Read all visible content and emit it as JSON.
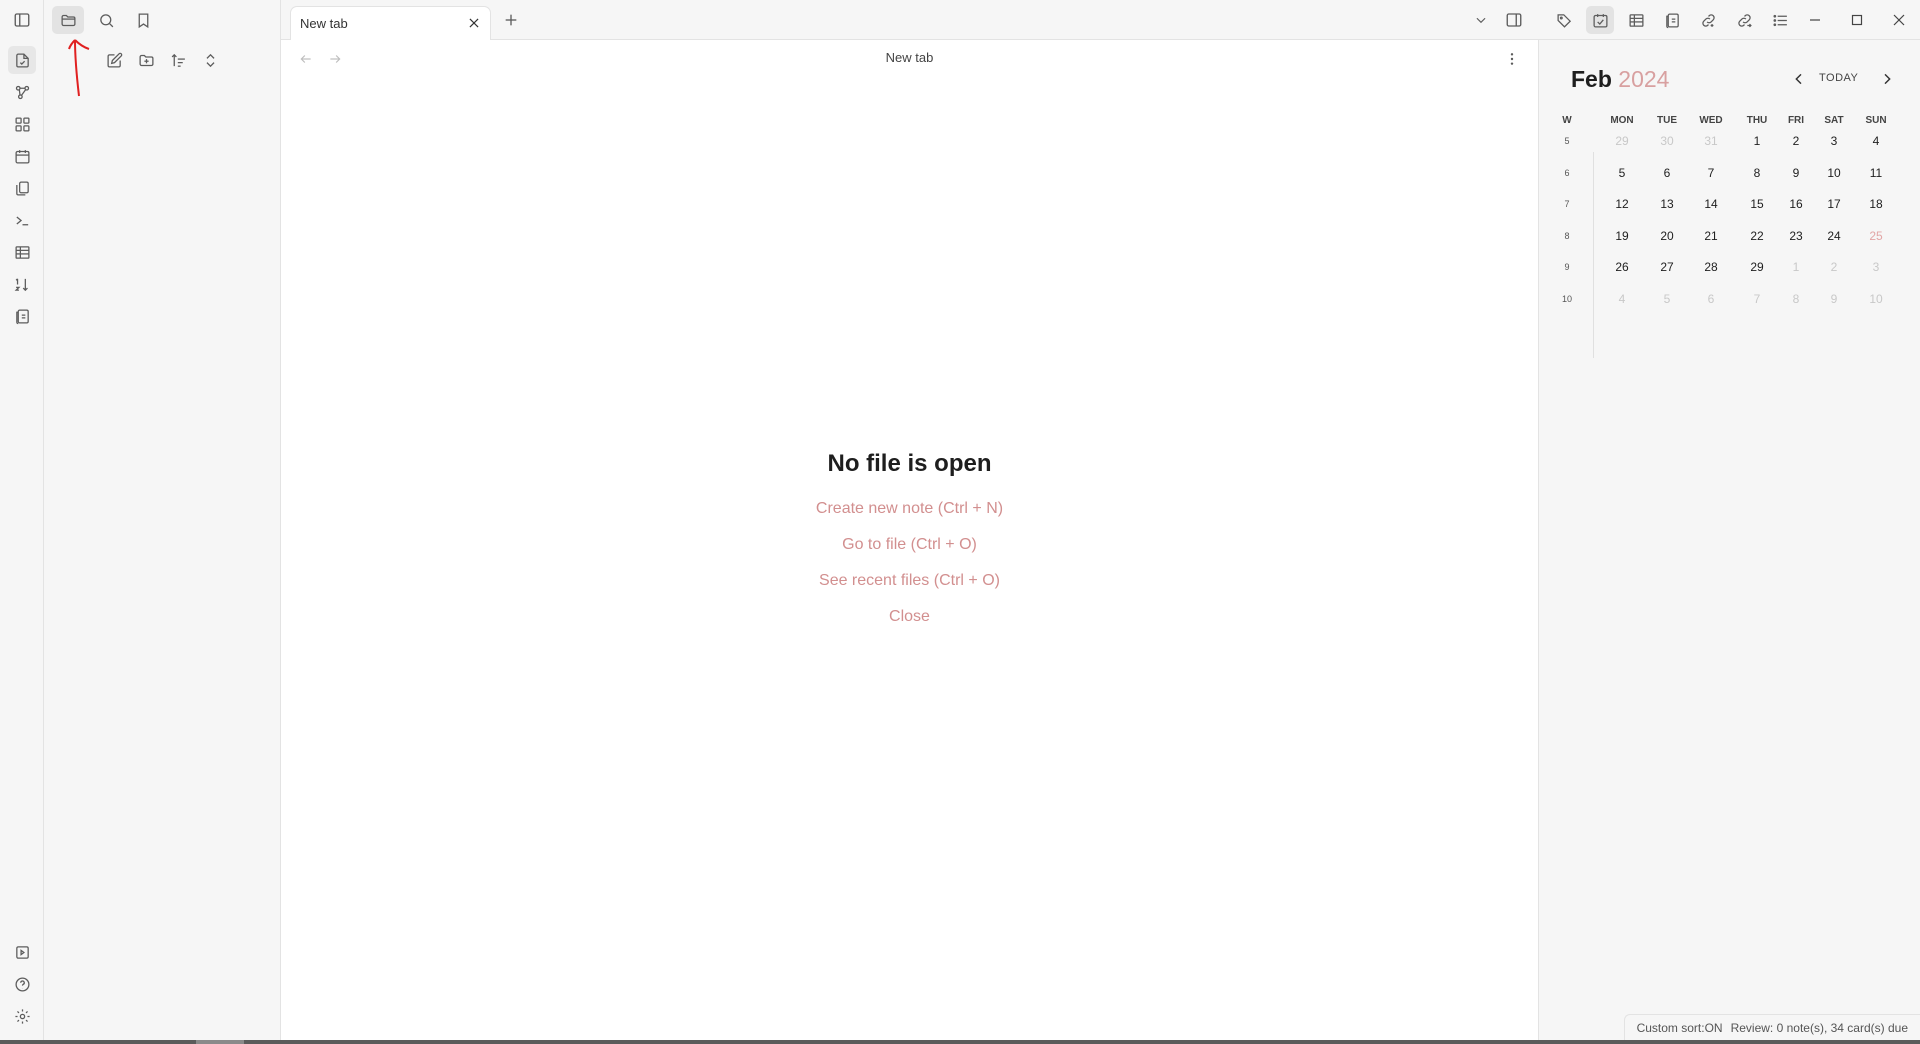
{
  "tabs": [
    {
      "title": "New tab",
      "active": true
    }
  ],
  "view": {
    "title": "New tab"
  },
  "empty_state": {
    "title": "No file is open",
    "actions": [
      "Create new note (Ctrl + N)",
      "Go to file (Ctrl + O)",
      "See recent files (Ctrl + O)",
      "Close"
    ]
  },
  "calendar": {
    "month": "Feb",
    "year": "2024",
    "today_label": "TODAY",
    "week_header": "W",
    "weekdays": [
      "MON",
      "TUE",
      "WED",
      "THU",
      "FRI",
      "SAT",
      "SUN"
    ],
    "weeks": [
      {
        "week": "5",
        "days": [
          {
            "d": "29",
            "adj": true
          },
          {
            "d": "30",
            "adj": true
          },
          {
            "d": "31",
            "adj": true
          },
          {
            "d": "1"
          },
          {
            "d": "2"
          },
          {
            "d": "3"
          },
          {
            "d": "4"
          }
        ]
      },
      {
        "week": "6",
        "days": [
          {
            "d": "5"
          },
          {
            "d": "6"
          },
          {
            "d": "7"
          },
          {
            "d": "8"
          },
          {
            "d": "9"
          },
          {
            "d": "10"
          },
          {
            "d": "11"
          }
        ]
      },
      {
        "week": "7",
        "days": [
          {
            "d": "12"
          },
          {
            "d": "13"
          },
          {
            "d": "14"
          },
          {
            "d": "15"
          },
          {
            "d": "16"
          },
          {
            "d": "17"
          },
          {
            "d": "18"
          }
        ]
      },
      {
        "week": "8",
        "days": [
          {
            "d": "19"
          },
          {
            "d": "20"
          },
          {
            "d": "21"
          },
          {
            "d": "22"
          },
          {
            "d": "23"
          },
          {
            "d": "24"
          },
          {
            "d": "25",
            "hl": true
          }
        ]
      },
      {
        "week": "9",
        "days": [
          {
            "d": "26"
          },
          {
            "d": "27"
          },
          {
            "d": "28"
          },
          {
            "d": "29"
          },
          {
            "d": "1",
            "adj": true
          },
          {
            "d": "2",
            "adj": true
          },
          {
            "d": "3",
            "adj": true
          }
        ]
      },
      {
        "week": "10",
        "days": [
          {
            "d": "4",
            "adj": true
          },
          {
            "d": "5",
            "adj": true
          },
          {
            "d": "6",
            "adj": true
          },
          {
            "d": "7",
            "adj": true
          },
          {
            "d": "8",
            "adj": true
          },
          {
            "d": "9",
            "adj": true
          },
          {
            "d": "10",
            "adj": true
          }
        ]
      }
    ]
  },
  "status_bar": {
    "sort": "Custom sort:ON",
    "review": "Review: 0 note(s), 34 card(s) due"
  },
  "colors": {
    "accent": "#d28f8f",
    "annotation": "#e02020"
  }
}
